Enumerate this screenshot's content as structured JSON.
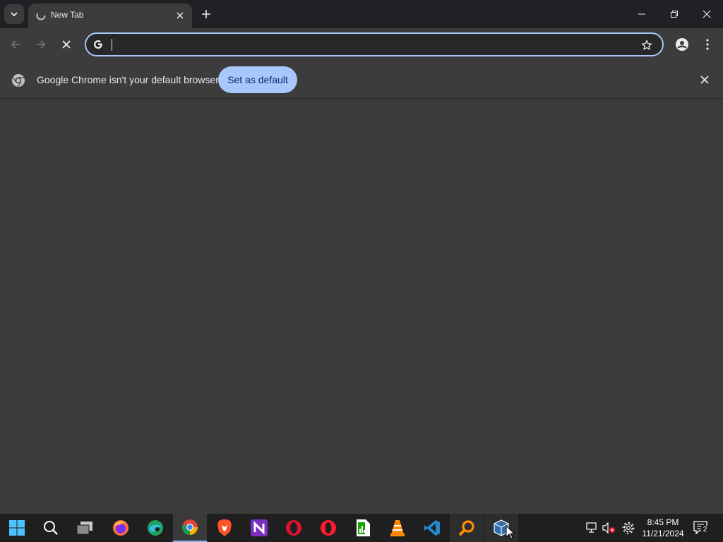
{
  "tab": {
    "title": "New Tab"
  },
  "omnibox": {
    "value": "",
    "placeholder": ""
  },
  "infobar": {
    "message": "Google Chrome isn't your default browser",
    "button_label": "Set as default"
  },
  "taskbar": {
    "apps": [
      "start-icon",
      "search-icon",
      "task-view-icon",
      "firefox-icon",
      "edge-icon",
      "chrome-icon",
      "brave-icon",
      "notion-icon",
      "opera-icon",
      "opera-gx-icon",
      "libreoffice-calc-icon",
      "vlc-icon",
      "vscode-icon",
      "search-everything-icon",
      "virtualbox-icon"
    ],
    "clock": {
      "time": "8:45 PM",
      "date": "11/21/2024"
    },
    "notification_count": "2"
  },
  "colors": {
    "accent": "#a8c7fa",
    "tab_bg": "#3c3c3c",
    "frame": "#202124",
    "taskbar": "#1f1f1f"
  }
}
